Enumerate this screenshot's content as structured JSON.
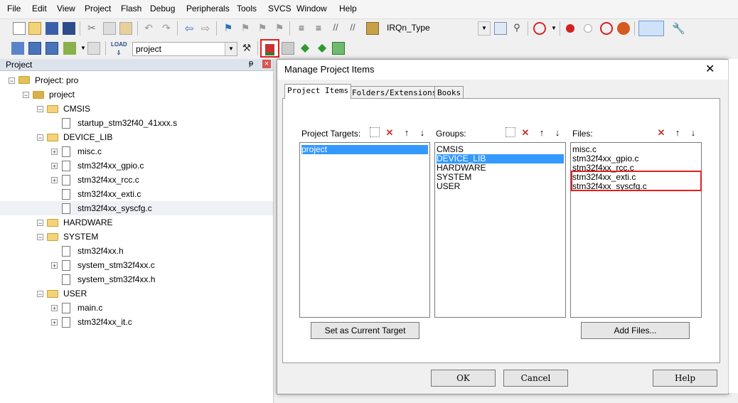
{
  "menu": [
    "File",
    "Edit",
    "View",
    "Project",
    "Flash",
    "Debug",
    "Peripherals",
    "Tools",
    "SVCS",
    "Window",
    "Help"
  ],
  "toolbar": {
    "find_combo": "IRQn_Type",
    "target_combo": "project"
  },
  "project_panel": {
    "title": "Project",
    "pin": "ᵽ",
    "close": "×",
    "tree": [
      {
        "label": "Project: pro",
        "level": 0,
        "type": "root"
      },
      {
        "label": "project",
        "level": 1,
        "type": "target"
      },
      {
        "label": "CMSIS",
        "level": 2,
        "type": "folder"
      },
      {
        "label": "startup_stm32f40_41xxx.s",
        "level": 3,
        "type": "file"
      },
      {
        "label": "DEVICE_LIB",
        "level": 2,
        "type": "folder"
      },
      {
        "label": "misc.c",
        "level": 3,
        "type": "file",
        "plus": true
      },
      {
        "label": "stm32f4xx_gpio.c",
        "level": 3,
        "type": "file",
        "plus": true
      },
      {
        "label": "stm32f4xx_rcc.c",
        "level": 3,
        "type": "file",
        "plus": true
      },
      {
        "label": "stm32f4xx_exti.c",
        "level": 3,
        "type": "file"
      },
      {
        "label": "stm32f4xx_syscfg.c",
        "level": 3,
        "type": "file",
        "selected": true
      },
      {
        "label": "HARDWARE",
        "level": 2,
        "type": "folder"
      },
      {
        "label": "SYSTEM",
        "level": 2,
        "type": "folder"
      },
      {
        "label": "stm32f4xx.h",
        "level": 3,
        "type": "file"
      },
      {
        "label": "system_stm32f4xx.c",
        "level": 3,
        "type": "file",
        "plus": true
      },
      {
        "label": "system_stm32f4xx.h",
        "level": 3,
        "type": "file"
      },
      {
        "label": "USER",
        "level": 2,
        "type": "folder"
      },
      {
        "label": "main.c",
        "level": 3,
        "type": "file",
        "plus": true
      },
      {
        "label": "stm32f4xx_it.c",
        "level": 3,
        "type": "file",
        "plus": true
      }
    ]
  },
  "dialog": {
    "title": "Manage Project Items",
    "close": "✕",
    "tabs": [
      "Project Items",
      "Folders/Extensions",
      "Books"
    ],
    "targets": {
      "label": "Project Targets:",
      "items": [
        "project"
      ]
    },
    "groups": {
      "label": "Groups:",
      "items": [
        "CMSIS",
        "DEVICE_LIB",
        "HARDWARE",
        "SYSTEM",
        "USER"
      ]
    },
    "files": {
      "label": "Files:",
      "items": [
        "misc.c",
        "stm32f4xx_gpio.c",
        "stm32f4xx_rcc.c",
        "stm32f4xx_exti.c",
        "stm32f4xx_syscfg.c"
      ]
    },
    "set_target_button": "Set as Current Target",
    "add_files_button": "Add Files...",
    "ok_button": "OK",
    "cancel_button": "Cancel",
    "help_button": "Help"
  },
  "colors": {
    "selection": "#3399ff",
    "highlight_box": "#e02020",
    "folder": "#f3d37a"
  }
}
